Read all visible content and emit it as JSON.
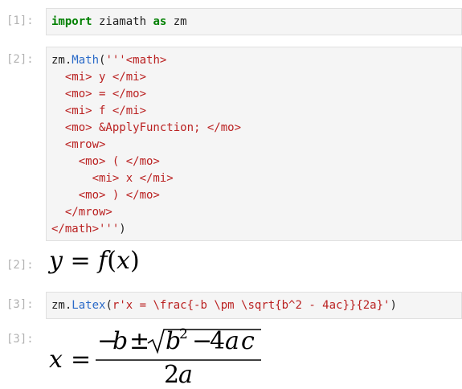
{
  "cells": [
    {
      "prompt": "[1]:",
      "code": {
        "kw1": "import",
        "mod": " ziamath ",
        "kw2": "as",
        "alias": " zm"
      }
    },
    {
      "prompt": "[2]:",
      "code": {
        "pre": "zm.",
        "fn": "Math",
        "open": "(",
        "lines": [
          "'''<math>",
          "  <mi> y </mi>",
          "  <mo> = </mo>",
          "  <mi> f </mi>",
          "  <mo> &ApplyFunction; </mo>",
          "  <mrow>",
          "    <mo> ( </mo>",
          "      <mi> x </mi>",
          "    <mo> ) </mo>",
          "  </mrow>",
          "</math>'''"
        ],
        "close": ")"
      },
      "output_prompt": "[2]:",
      "output": {
        "y": "y",
        "eq": "=",
        "f": "f",
        "lp": "(",
        "x": "x",
        "rp": ")"
      }
    },
    {
      "prompt": "[3]:",
      "code": {
        "pre": "zm.",
        "fn": "Latex",
        "open": "(",
        "str": "r'x = \\frac{-b \\pm \\sqrt{b^2 - 4ac}}{2a}'",
        "close": ")"
      },
      "output_prompt": "[3]:",
      "output": {
        "lhs": "x",
        "eq": "=",
        "minus": "−",
        "b": "b",
        "pm": "±",
        "b2": "b",
        "exp": "2",
        "minus2": "−",
        "four": "4",
        "a": "a",
        "c": "c",
        "den2": "2",
        "dena": "a"
      }
    }
  ]
}
